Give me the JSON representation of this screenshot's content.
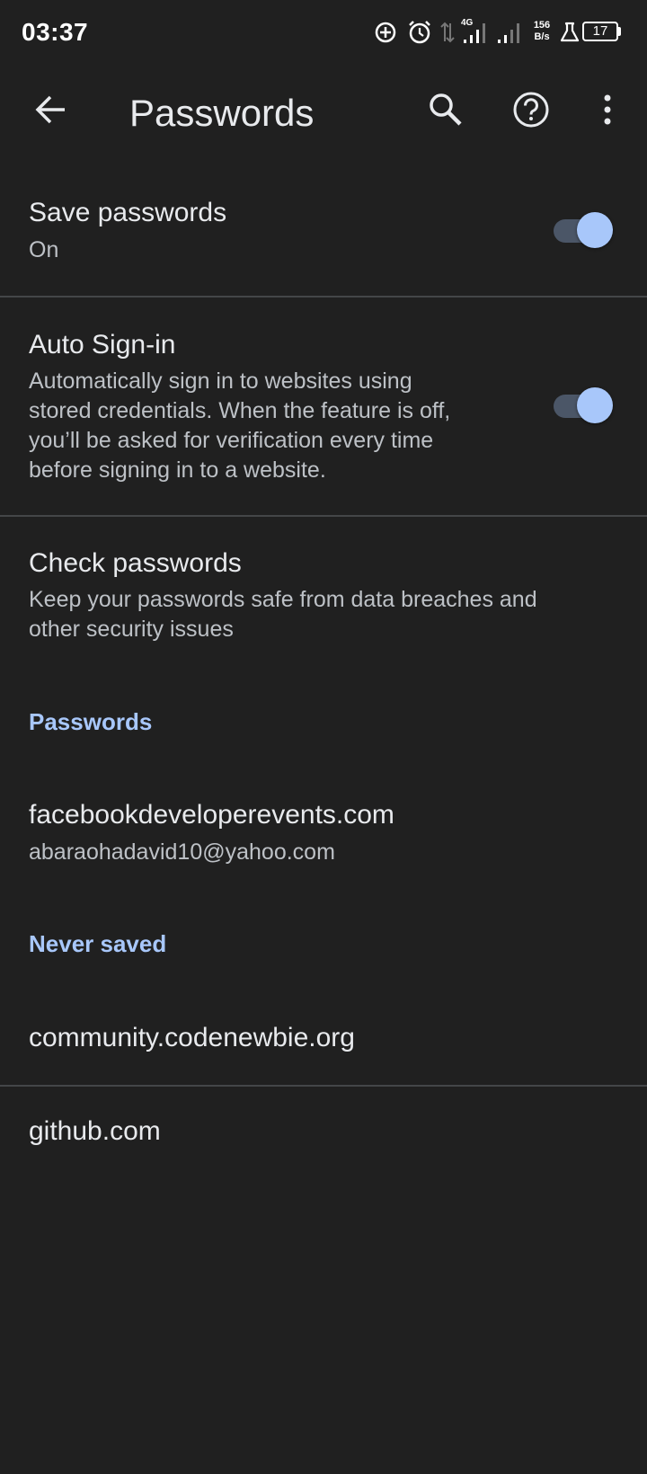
{
  "status_bar": {
    "time": "03:37",
    "network_type": "4G",
    "speed_value": "156",
    "speed_unit": "B/s",
    "battery": "17",
    "icons": [
      "data-saver-icon",
      "alarm-icon",
      "data-transfer-icon",
      "signal-icon",
      "signal-icon-2",
      "lab-icon",
      "battery-icon"
    ]
  },
  "app_bar": {
    "title": "Passwords",
    "icons": [
      "back-arrow-icon",
      "search-icon",
      "help-icon",
      "more-vert-icon"
    ]
  },
  "settings": {
    "save_passwords": {
      "title": "Save passwords",
      "subtitle": "On",
      "enabled": true
    },
    "auto_signin": {
      "title": "Auto Sign-in",
      "description_lines": [
        "Automatically sign in to websites using",
        "stored credentials. When the feature is off,",
        "you’ll be asked for verification every time",
        "before signing in to a website."
      ],
      "enabled": true
    },
    "check_passwords": {
      "title": "Check passwords",
      "description_lines": [
        "Keep your passwords safe from data breaches and",
        "other security issues"
      ]
    }
  },
  "passwords_section": {
    "header": "Passwords",
    "entries": [
      {
        "site": "facebookdeveloperevents.com",
        "username": "abaraohadavid10@yahoo.com"
      }
    ]
  },
  "never_saved_section": {
    "header": "Never saved",
    "sites": [
      "community.codenewbie.org",
      "github.com"
    ]
  },
  "colors": {
    "background": "#202020",
    "accent": "#a8c7fa",
    "text_primary": "#e8eaed",
    "text_secondary": "#bdc1c6"
  }
}
